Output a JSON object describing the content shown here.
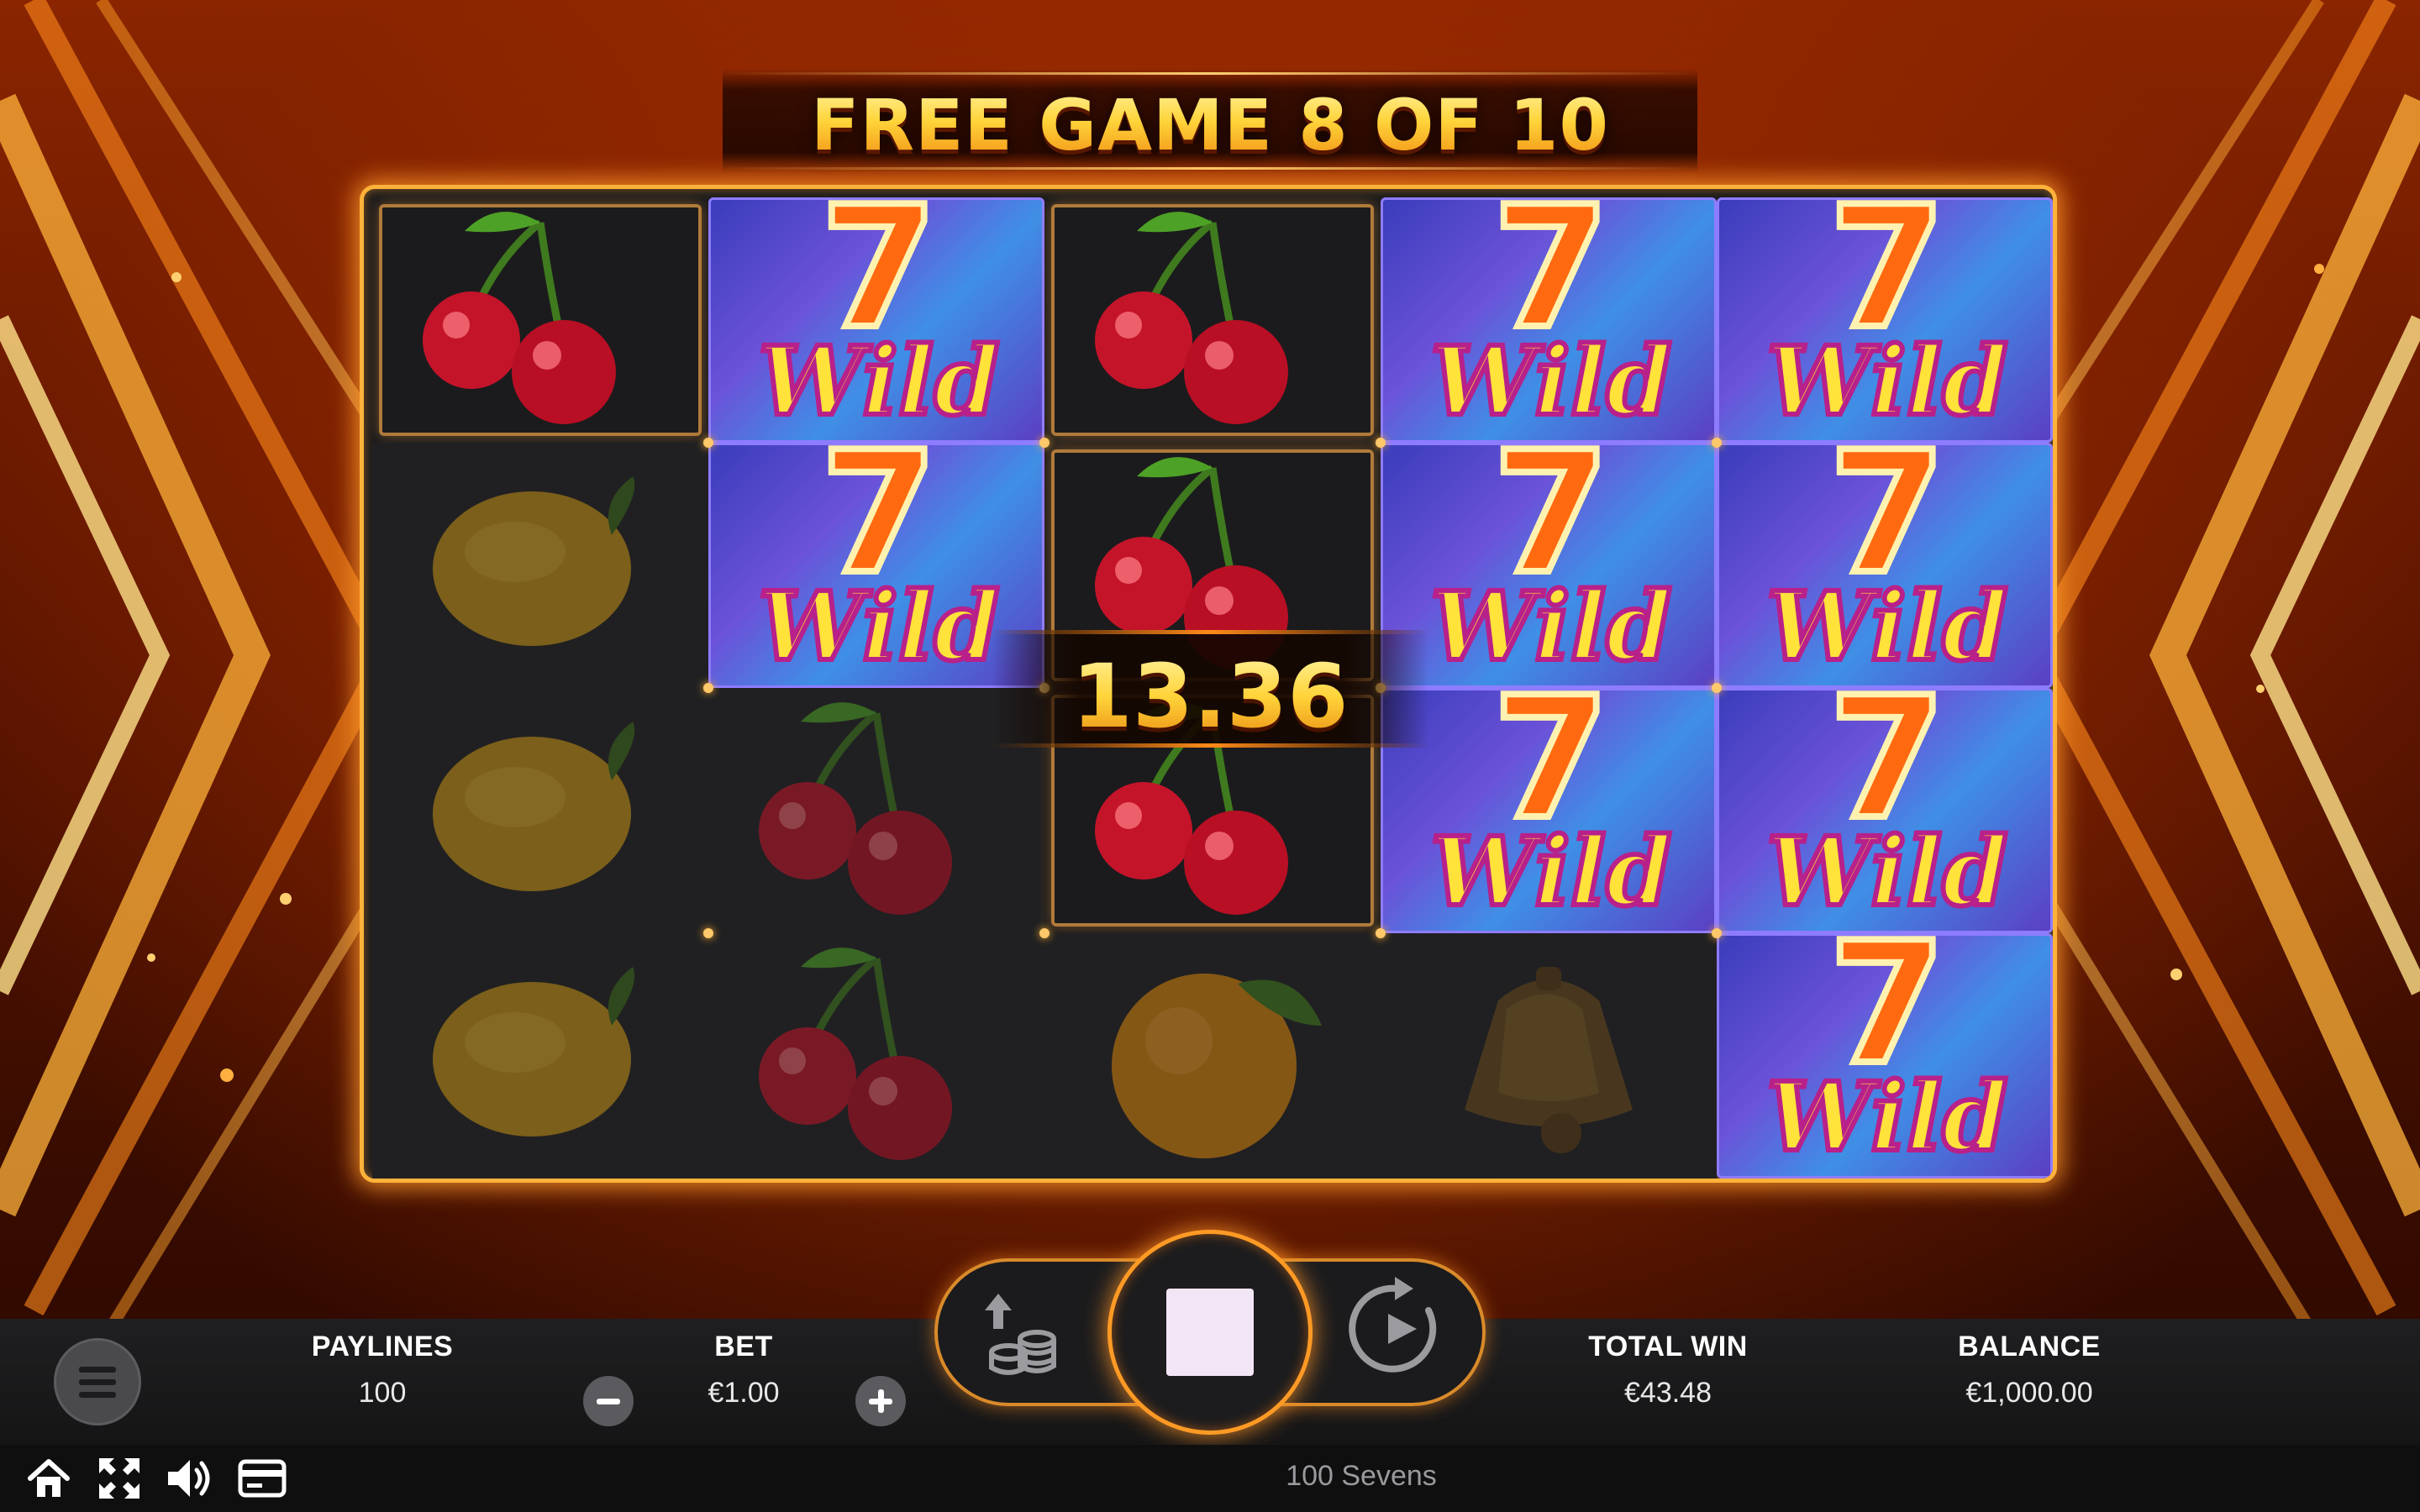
{
  "header": {
    "title": "FREE GAME 8 OF 10"
  },
  "win_display": {
    "amount": "13.36"
  },
  "reels": [
    [
      "cherry",
      "lemon",
      "lemon",
      "lemon"
    ],
    [
      "wild",
      "wild",
      "cherry",
      "cherry"
    ],
    [
      "cherry",
      "cherry",
      "cherry",
      "orange"
    ],
    [
      "wild",
      "wild",
      "wild",
      "bell"
    ],
    [
      "wild",
      "wild",
      "wild",
      "wild"
    ]
  ],
  "wild_symbol": {
    "number": "7",
    "word": "Wild"
  },
  "panel": {
    "paylines_label": "PAYLINES",
    "paylines_value": "100",
    "bet_label": "BET",
    "bet_value": "€1.00",
    "total_win_label": "TOTAL WIN",
    "total_win_value": "€43.48",
    "balance_label": "BALANCE",
    "balance_value": "€1,000.00"
  },
  "status": {
    "game_name": "100 Sevens"
  },
  "icons": [
    "menu-icon",
    "minus-icon",
    "plus-icon",
    "coins-icon",
    "stop-icon",
    "autoplay-icon",
    "home-icon",
    "fullscreen-icon",
    "sound-icon",
    "history-icon"
  ],
  "colors": {
    "accent": "#ff9a25",
    "frame": "#ffb23a",
    "title_gold": "#ffd43a"
  }
}
